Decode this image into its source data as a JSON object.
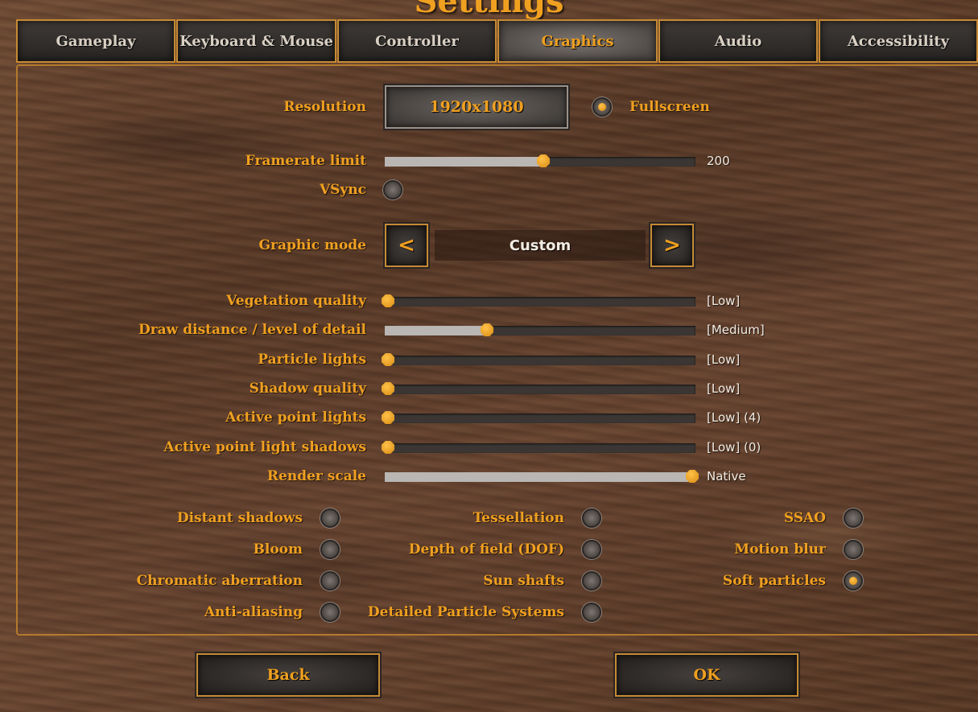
{
  "title": "Settings",
  "tabs": [
    {
      "label": "Gameplay"
    },
    {
      "label": "Keyboard & Mouse"
    },
    {
      "label": "Controller"
    },
    {
      "label": "Graphics",
      "active": true
    },
    {
      "label": "Audio"
    },
    {
      "label": "Accessibility"
    }
  ],
  "resolution": {
    "label": "Resolution",
    "value": "1920x1080"
  },
  "fullscreen": {
    "label": "Fullscreen",
    "checked": true
  },
  "framerate": {
    "label": "Framerate limit",
    "value": "200",
    "fraction": 0.51
  },
  "vsync": {
    "label": "VSync",
    "checked": false
  },
  "graphic_mode": {
    "label": "Graphic mode",
    "value": "Custom",
    "prev": "<",
    "next": ">"
  },
  "sliders": [
    {
      "label": "Vegetation quality",
      "value": "[Low]",
      "fraction": 0.0
    },
    {
      "label": "Draw distance / level of detail",
      "value": "[Medium]",
      "fraction": 0.33
    },
    {
      "label": "Particle lights",
      "value": "[Low]",
      "fraction": 0.0
    },
    {
      "label": "Shadow quality",
      "value": "[Low]",
      "fraction": 0.0
    },
    {
      "label": "Active point lights",
      "value": "[Low] (4)",
      "fraction": 0.0
    },
    {
      "label": "Active point light shadows",
      "value": "[Low] (0)",
      "fraction": 0.0
    },
    {
      "label": "Render scale",
      "value": "Native",
      "fraction": 0.99
    }
  ],
  "toggles_col1": [
    {
      "label": "Distant shadows",
      "checked": false
    },
    {
      "label": "Bloom",
      "checked": false
    },
    {
      "label": "Chromatic aberration",
      "checked": false
    },
    {
      "label": "Anti-aliasing",
      "checked": false
    }
  ],
  "toggles_col2": [
    {
      "label": "Tessellation",
      "checked": false
    },
    {
      "label": "Depth of field (DOF)",
      "checked": false
    },
    {
      "label": "Sun shafts",
      "checked": false
    },
    {
      "label": "Detailed Particle Systems",
      "checked": false
    }
  ],
  "toggles_col3": [
    {
      "label": "SSAO",
      "checked": false
    },
    {
      "label": "Motion blur",
      "checked": false
    },
    {
      "label": "Soft particles",
      "checked": true
    }
  ],
  "buttons": {
    "back": "Back",
    "ok": "OK"
  },
  "colors": {
    "accent": "#f0a020",
    "value_text": "#f3ece2",
    "frame": "#c68a34"
  }
}
